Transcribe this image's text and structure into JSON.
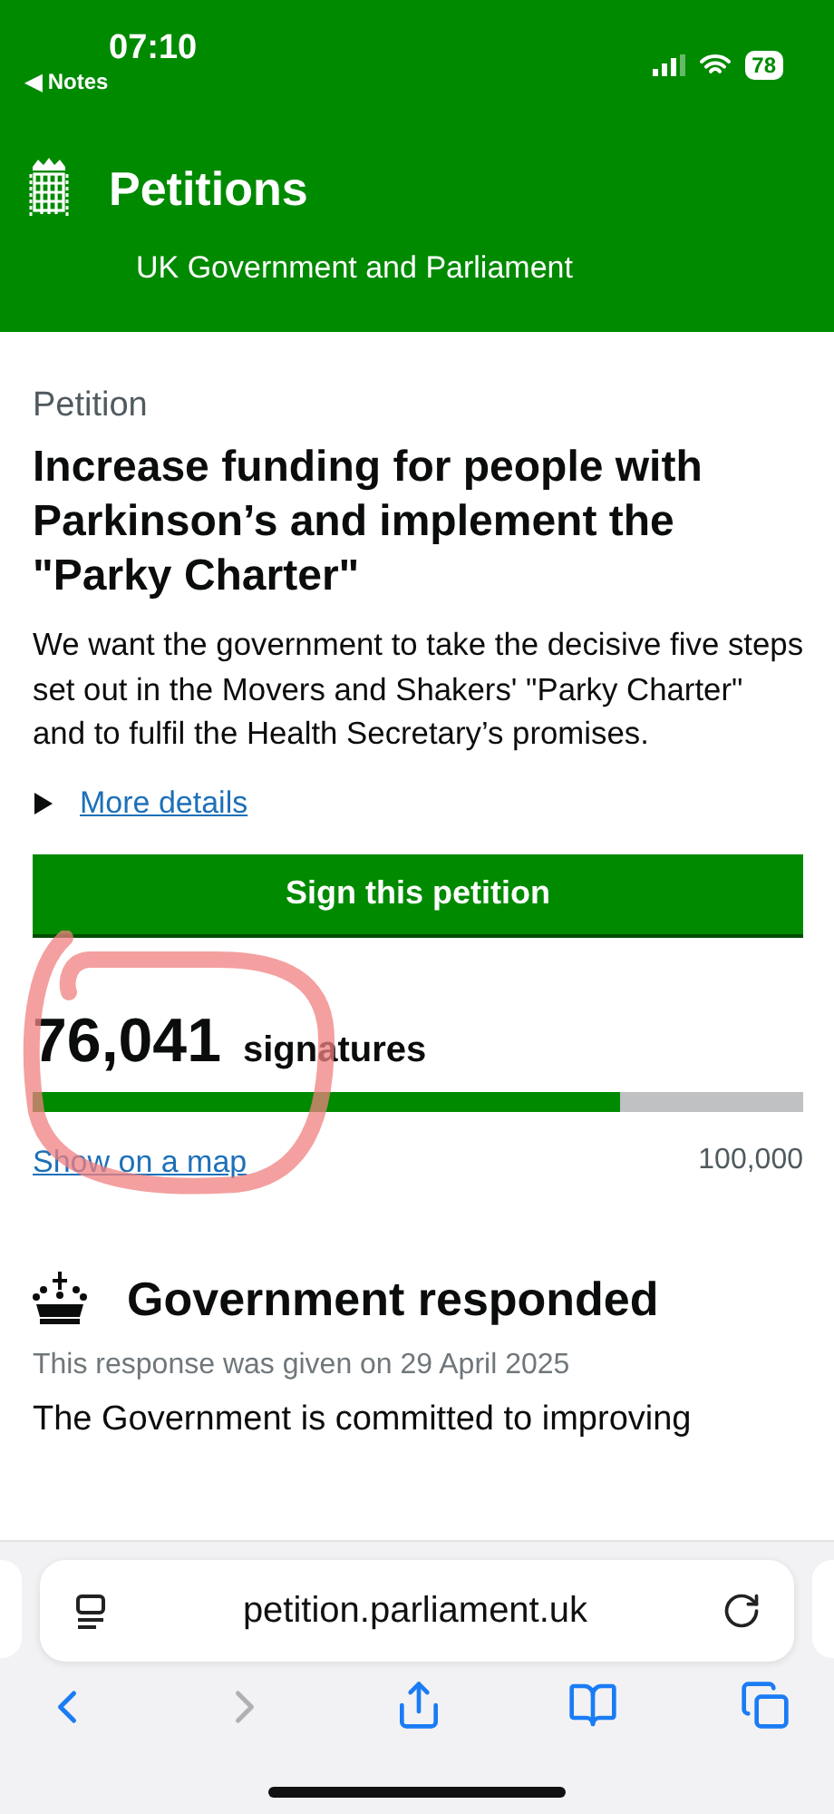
{
  "status_bar": {
    "time": "07:10",
    "back_app": "◀ Notes",
    "battery": "78"
  },
  "header": {
    "title": "Petitions",
    "subtitle": "UK Government and Parliament"
  },
  "petition": {
    "label": "Petition",
    "title": "Increase funding for people with Parkinson’s and implement the \"Parky Charter\"",
    "description": "We want the government to take the decisive five steps set out in the Movers and Shakers' \"Parky Charter\" and to fulfil the Health Secretary’s promises.",
    "details_link": "More details",
    "details_expanded": false,
    "sign_button": "Sign this petition"
  },
  "signatures": {
    "count": "76,041",
    "label": "signatures",
    "level": 0.762,
    "map_link": "Show on a map",
    "target": "100,000",
    "annotated": true
  },
  "response": {
    "title": "Government responded",
    "date": "This response was given on 29 April 2025",
    "body": "The Government is committed to improving"
  },
  "browser": {
    "url": "petition.parliament.uk",
    "back_disabled": false,
    "forward_disabled": true
  }
}
